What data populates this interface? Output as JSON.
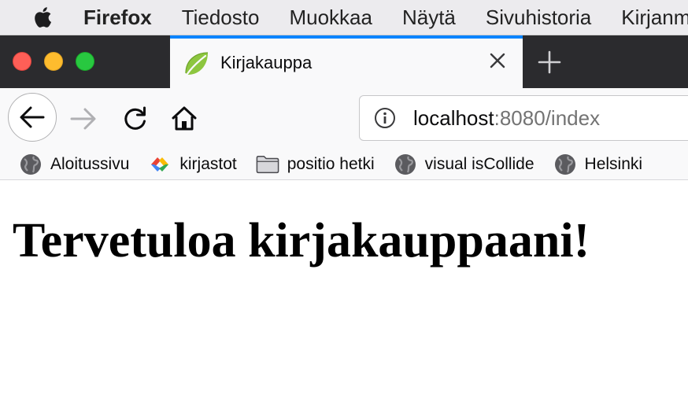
{
  "menubar": {
    "app_name": "Firefox",
    "items": [
      "Tiedosto",
      "Muokkaa",
      "Näytä",
      "Sivuhistoria",
      "Kirjanmerkit"
    ]
  },
  "tab": {
    "title": "Kirjakauppa",
    "favicon": "spring-leaf-icon"
  },
  "navbar": {
    "url_host": "localhost",
    "url_rest": ":8080/index"
  },
  "bookmarks": [
    {
      "label": "Aloitussivu",
      "icon": "globe-icon"
    },
    {
      "label": "kirjastot",
      "icon": "google-chevron-icon"
    },
    {
      "label": "positio hetki",
      "icon": "folder-icon"
    },
    {
      "label": "visual isCollide",
      "icon": "globe-icon"
    },
    {
      "label": "Helsinki",
      "icon": "globe-icon"
    }
  ],
  "page": {
    "heading": "Tervetuloa kirjakauppaani!"
  },
  "colors": {
    "tab_accent": "#0a84ff",
    "tabstrip_bg": "#2b2b2e",
    "toolbar_bg": "#f9f9fa"
  }
}
